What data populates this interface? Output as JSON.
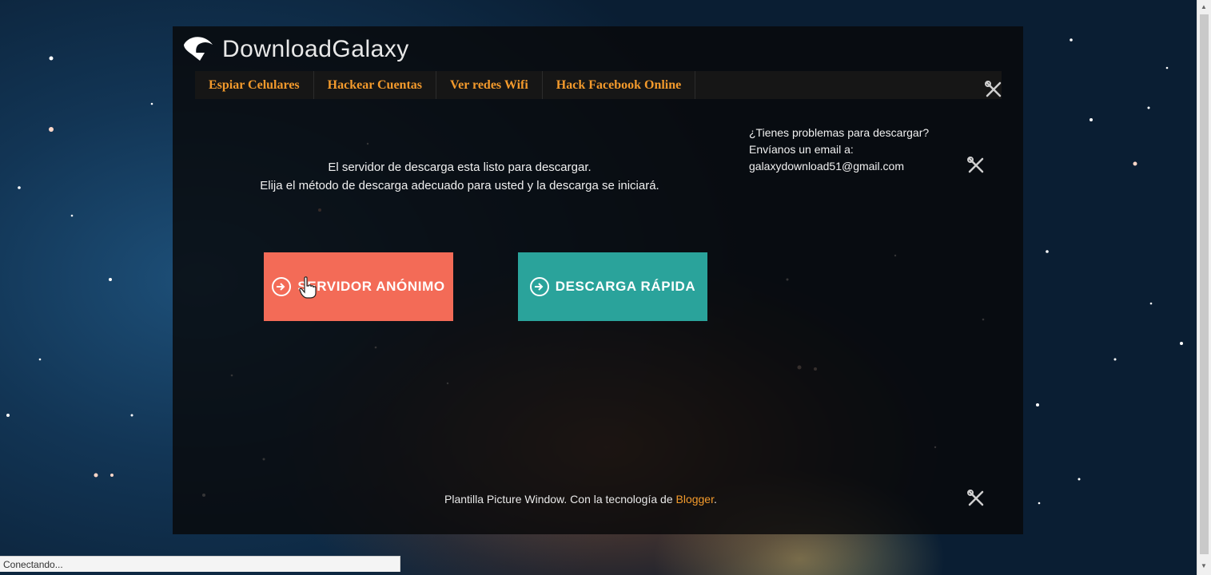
{
  "brand": {
    "name": "DownloadGalaxy"
  },
  "nav": {
    "items": [
      {
        "label": "Espiar Celulares"
      },
      {
        "label": "Hackear Cuentas"
      },
      {
        "label": "Ver redes Wifi"
      },
      {
        "label": "Hack Facebook Online"
      }
    ]
  },
  "main": {
    "line1": "El servidor de descarga esta listo para descargar.",
    "line2": "Elija el método de descarga adecuado para usted y la descarga se iniciará."
  },
  "side": {
    "line1": "¿Tienes problemas para descargar?",
    "line2": "Envíanos un email a:",
    "email": "galaxydownload51@gmail.com"
  },
  "buttons": {
    "anonymous": "SERVIDOR ANÓNIMO",
    "fast": "DESCARGA RÁPIDA"
  },
  "footer": {
    "text": "Plantilla Picture Window. Con la tecnología de ",
    "link": "Blogger",
    "suffix": "."
  },
  "status": {
    "text": "Conectando..."
  },
  "colors": {
    "accent": "#f39a2c",
    "button_anonymous": "#f36b57",
    "button_fast": "#2aa39b"
  }
}
